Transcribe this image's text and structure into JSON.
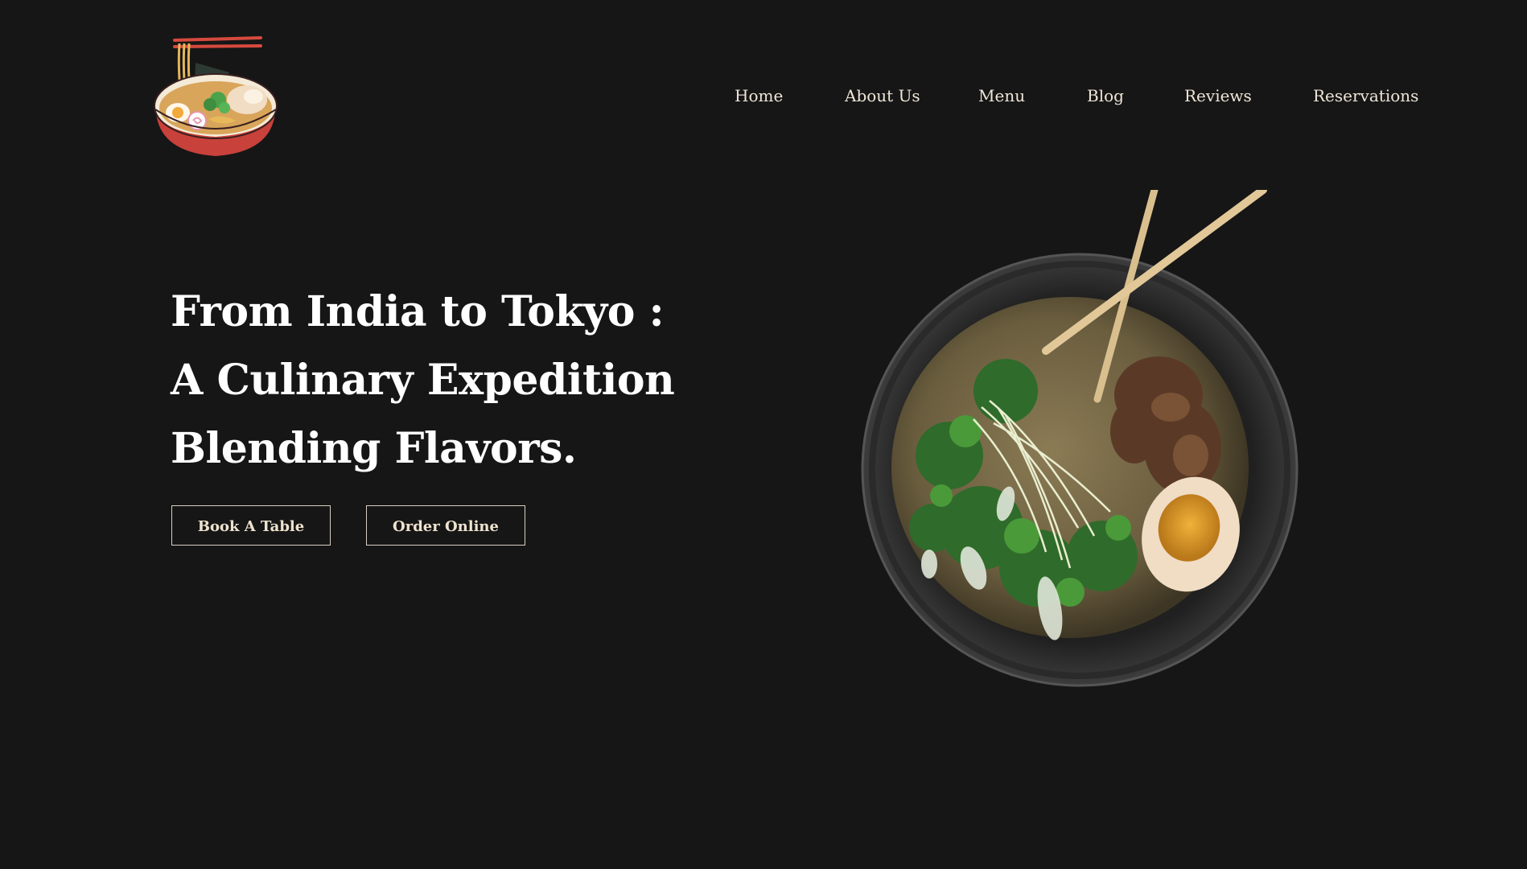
{
  "logo": {
    "icon": "ramen-bowl-logo-icon"
  },
  "nav": {
    "items": [
      {
        "label": "Home"
      },
      {
        "label": "About Us"
      },
      {
        "label": "Menu"
      },
      {
        "label": "Blog"
      },
      {
        "label": "Reviews"
      },
      {
        "label": "Reservations"
      }
    ]
  },
  "hero": {
    "title_lines": [
      "From India to Tokyo :",
      "A Culinary Expedition",
      "Blending Flavors."
    ],
    "buttons": {
      "book": "Book A Table",
      "order": "Order Online"
    },
    "image": {
      "icon": "ramen-bowl-photo"
    }
  },
  "colors": {
    "background": "#161616",
    "text": "#ffffff",
    "nav_text": "#efe6d8",
    "button_border": "#d9cfc1",
    "logo_bowl_red": "#c8413a"
  }
}
